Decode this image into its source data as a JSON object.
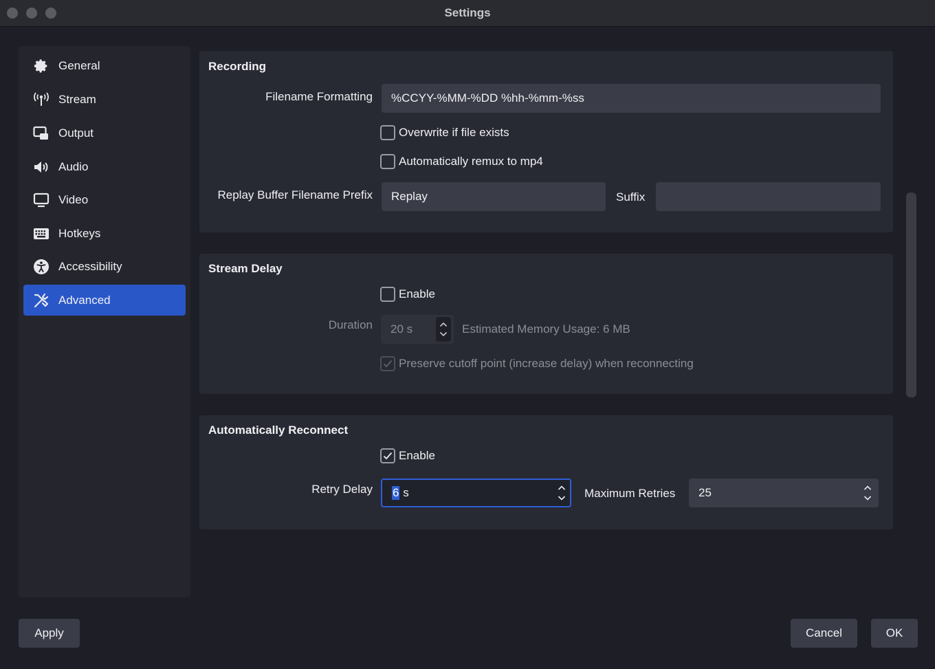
{
  "window": {
    "title": "Settings"
  },
  "sidebar": {
    "items": [
      {
        "label": "General",
        "icon": "gear-icon",
        "active": false
      },
      {
        "label": "Stream",
        "icon": "broadcast-icon",
        "active": false
      },
      {
        "label": "Output",
        "icon": "output-icon",
        "active": false
      },
      {
        "label": "Audio",
        "icon": "speaker-icon",
        "active": false
      },
      {
        "label": "Video",
        "icon": "monitor-icon",
        "active": false
      },
      {
        "label": "Hotkeys",
        "icon": "keyboard-icon",
        "active": false
      },
      {
        "label": "Accessibility",
        "icon": "accessibility-icon",
        "active": false
      },
      {
        "label": "Advanced",
        "icon": "tools-icon",
        "active": true
      }
    ]
  },
  "recording": {
    "title": "Recording",
    "filename_label": "Filename Formatting",
    "filename_value": "%CCYY-%MM-%DD %hh-%mm-%ss",
    "overwrite_label": "Overwrite if file exists",
    "overwrite_checked": false,
    "remux_label": "Automatically remux to mp4",
    "remux_checked": false,
    "replay_prefix_label": "Replay Buffer Filename Prefix",
    "replay_prefix_value": "Replay",
    "suffix_label": "Suffix",
    "suffix_value": ""
  },
  "stream_delay": {
    "title": "Stream Delay",
    "enable_label": "Enable",
    "enable_checked": false,
    "duration_label": "Duration",
    "duration_value": "20 s",
    "memory_usage": "Estimated Memory Usage: 6 MB",
    "preserve_label": "Preserve cutoff point (increase delay) when reconnecting",
    "preserve_checked": true
  },
  "reconnect": {
    "title": "Automatically Reconnect",
    "enable_label": "Enable",
    "enable_checked": true,
    "retry_delay_label": "Retry Delay",
    "retry_delay_selected": "6",
    "retry_delay_unit": " s",
    "max_retries_label": "Maximum Retries",
    "max_retries_value": "25"
  },
  "footer": {
    "apply_label": "Apply",
    "cancel_label": "Cancel",
    "ok_label": "OK"
  },
  "colors": {
    "accent": "#2a57c8",
    "background": "#1d1e26",
    "panel": "#282a33",
    "field": "#3a3c47"
  }
}
